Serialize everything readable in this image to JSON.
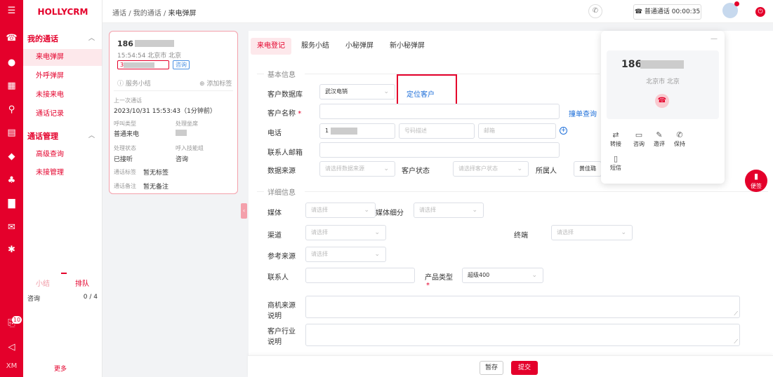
{
  "app": {
    "logo": "HOLLYCRM"
  },
  "rail": {
    "icons": [
      "menu-icon",
      "phone-icon",
      "chat-icon",
      "grid-icon",
      "user-icon",
      "document-icon",
      "shield-icon",
      "robot-icon",
      "bar-chart-icon",
      "message-icon",
      "settings-icon",
      "tasks-icon",
      "collapse-icon"
    ],
    "tasks_badge": "10",
    "footer": "XM"
  },
  "sidebar": {
    "groups": [
      {
        "label": "我的通话",
        "items": [
          "来电弹屏",
          "外呼弹屏",
          "未接来电",
          "通话记录"
        ]
      },
      {
        "label": "通话管理",
        "items": [
          "高级查询",
          "未接管理"
        ]
      }
    ],
    "active_item": "来电弹屏",
    "queue_tabs": [
      "小结",
      "排队"
    ],
    "queue_row": {
      "label": "咨询",
      "value": "0 / 4"
    },
    "more": "更多"
  },
  "topbar": {
    "breadcrumb": [
      "通话",
      "我的通话",
      "来电弹屏"
    ],
    "sep": "/",
    "call_status": "☎ 普通通话 00:00:35"
  },
  "call_card": {
    "number": "186",
    "time_location": "15:54:54 北京市 北京",
    "id_prefix": "3",
    "consult_tag": "咨询",
    "service_summary": "ⓘ 服务小结",
    "add_tag": "⊕ 添加标签",
    "last_call_label": "上一次通话",
    "last_call_time": "2023/10/31 15:53:43（1分钟前）",
    "call_type_label": "呼叫类型",
    "call_type_value": "普通来电",
    "handler_label": "处理坐席",
    "handle_status_label": "处理状态",
    "handle_status_value": "已接听",
    "skill_group_label": "呼入技能组",
    "skill_group_value": "咨询",
    "call_tag_label": "通话标签",
    "call_tag_value": "暂无标签",
    "call_note_label": "通话备注",
    "call_note_value": "暂无备注"
  },
  "form": {
    "tabs": [
      "来电登记",
      "服务小结",
      "小秘弹屏",
      "新小秘弹屏"
    ],
    "active_tab": "来电登记",
    "basic_info": "基本信息",
    "detail_info": "详细信息",
    "labels": {
      "customer_db": "客户数据库",
      "customer_name": "客户名称",
      "phone": "电话",
      "contact_email": "联系人邮箱",
      "data_source": "数据来源",
      "customer_status": "客户状态",
      "owner": "所属人",
      "media": "媒体",
      "media_sub": "媒体细分",
      "channel": "渠道",
      "terminal": "终端",
      "ref_source": "参考来源",
      "contact": "联系人",
      "product_type": "产品类型",
      "biz_source_desc": "商机来源说明",
      "industry_desc": "客户行业说明"
    },
    "required_mark": "*",
    "values": {
      "customer_db": "武汉电销",
      "phone_prefix": "1",
      "owner": "黄佳璐",
      "product_type": "超级400"
    },
    "placeholders": {
      "data_source": "请选择数据来源",
      "customer_status": "请选择客户状态",
      "select": "请选择",
      "phone_desc": "号码描述",
      "email": "邮箱"
    },
    "locate_customer": "定位客户",
    "duplicate_check": "撞单查询"
  },
  "actions": {
    "save": "暂存",
    "submit": "提交"
  },
  "float_panel": {
    "number": "186",
    "location": "北京市 北京",
    "actions": [
      {
        "icon": "transfer-icon",
        "label": "转接"
      },
      {
        "icon": "consult-icon",
        "label": "咨询"
      },
      {
        "icon": "evaluate-icon",
        "label": "邀评"
      },
      {
        "icon": "hold-icon",
        "label": "保持"
      },
      {
        "icon": "sms-icon",
        "label": "短信"
      }
    ]
  },
  "note_button": {
    "label": "便签"
  },
  "colors": {
    "brand": "#e4002b",
    "link": "#1e6fd9"
  }
}
